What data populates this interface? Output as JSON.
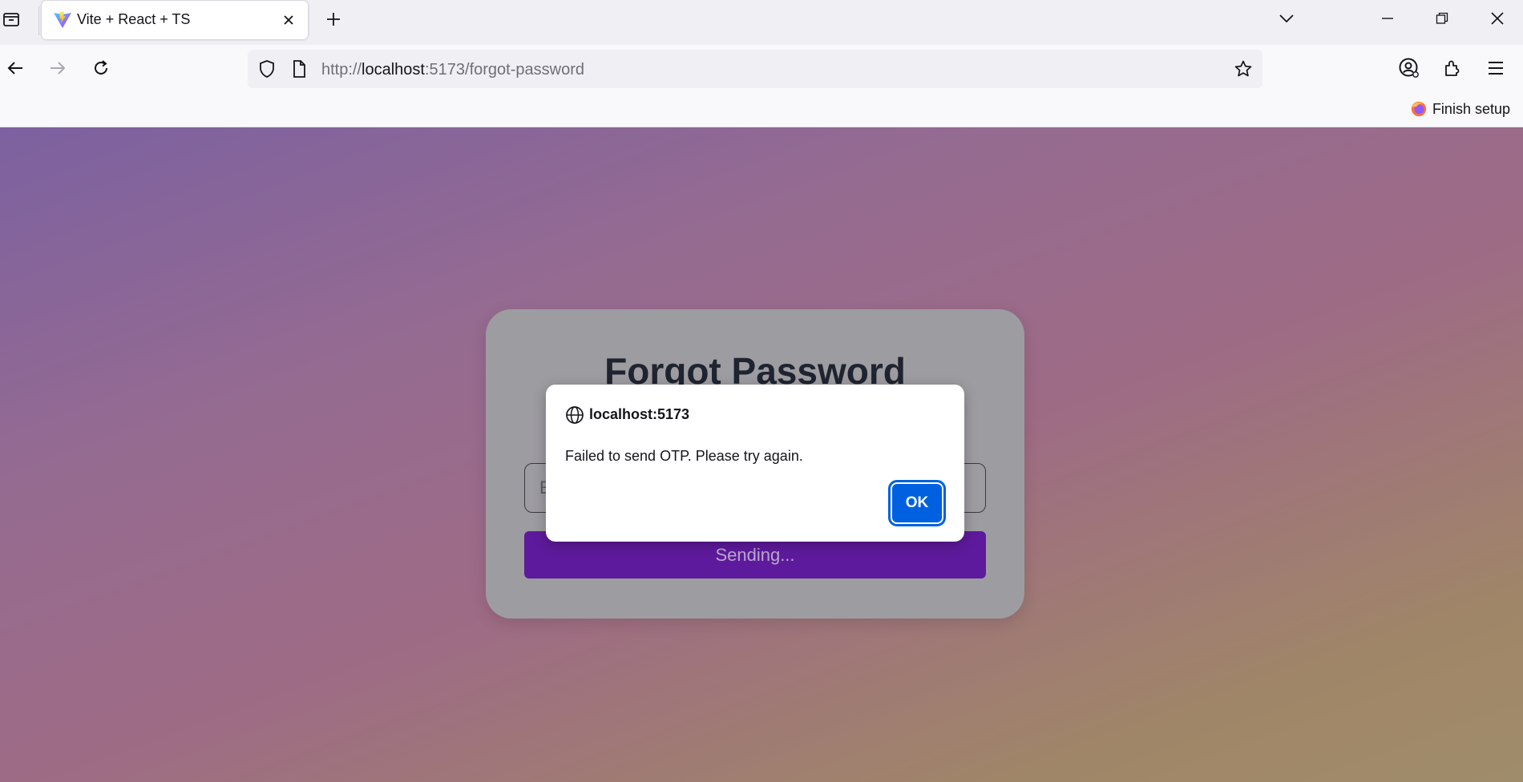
{
  "browser": {
    "tab": {
      "title": "Vite + React + TS"
    },
    "url": {
      "scheme": "http://",
      "host": "localhost",
      "rest": ":5173/forgot-password"
    },
    "setup_button": "Finish setup"
  },
  "page": {
    "title": "Forgot Password",
    "email_placeholder": "Email",
    "submit_label": "Sending..."
  },
  "dialog": {
    "origin": "localhost:5173",
    "message": "Failed to send OTP. Please try again.",
    "ok_label": "OK"
  },
  "colors": {
    "accent": "#0061e0",
    "submit_button": "#5e1a9c",
    "card": "#9d9ca1"
  }
}
